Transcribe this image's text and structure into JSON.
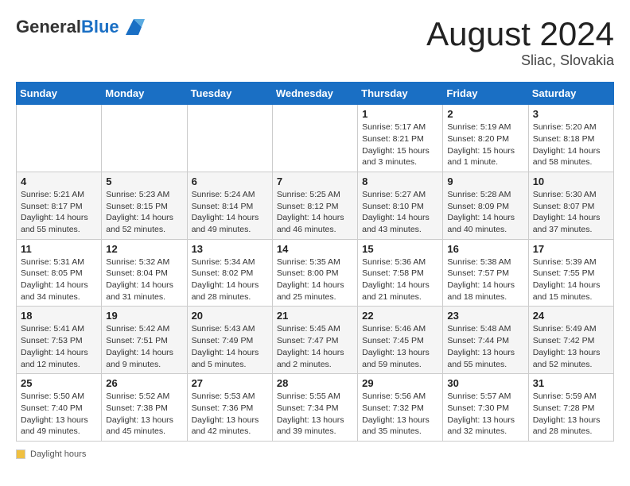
{
  "header": {
    "logo_general": "General",
    "logo_blue": "Blue",
    "month": "August 2024",
    "location": "Sliac, Slovakia"
  },
  "footer": {
    "label": "Daylight hours"
  },
  "weekdays": [
    "Sunday",
    "Monday",
    "Tuesday",
    "Wednesday",
    "Thursday",
    "Friday",
    "Saturday"
  ],
  "weeks": [
    [
      {
        "day": "",
        "info": ""
      },
      {
        "day": "",
        "info": ""
      },
      {
        "day": "",
        "info": ""
      },
      {
        "day": "",
        "info": ""
      },
      {
        "day": "1",
        "info": "Sunrise: 5:17 AM\nSunset: 8:21 PM\nDaylight: 15 hours\nand 3 minutes."
      },
      {
        "day": "2",
        "info": "Sunrise: 5:19 AM\nSunset: 8:20 PM\nDaylight: 15 hours\nand 1 minute."
      },
      {
        "day": "3",
        "info": "Sunrise: 5:20 AM\nSunset: 8:18 PM\nDaylight: 14 hours\nand 58 minutes."
      }
    ],
    [
      {
        "day": "4",
        "info": "Sunrise: 5:21 AM\nSunset: 8:17 PM\nDaylight: 14 hours\nand 55 minutes."
      },
      {
        "day": "5",
        "info": "Sunrise: 5:23 AM\nSunset: 8:15 PM\nDaylight: 14 hours\nand 52 minutes."
      },
      {
        "day": "6",
        "info": "Sunrise: 5:24 AM\nSunset: 8:14 PM\nDaylight: 14 hours\nand 49 minutes."
      },
      {
        "day": "7",
        "info": "Sunrise: 5:25 AM\nSunset: 8:12 PM\nDaylight: 14 hours\nand 46 minutes."
      },
      {
        "day": "8",
        "info": "Sunrise: 5:27 AM\nSunset: 8:10 PM\nDaylight: 14 hours\nand 43 minutes."
      },
      {
        "day": "9",
        "info": "Sunrise: 5:28 AM\nSunset: 8:09 PM\nDaylight: 14 hours\nand 40 minutes."
      },
      {
        "day": "10",
        "info": "Sunrise: 5:30 AM\nSunset: 8:07 PM\nDaylight: 14 hours\nand 37 minutes."
      }
    ],
    [
      {
        "day": "11",
        "info": "Sunrise: 5:31 AM\nSunset: 8:05 PM\nDaylight: 14 hours\nand 34 minutes."
      },
      {
        "day": "12",
        "info": "Sunrise: 5:32 AM\nSunset: 8:04 PM\nDaylight: 14 hours\nand 31 minutes."
      },
      {
        "day": "13",
        "info": "Sunrise: 5:34 AM\nSunset: 8:02 PM\nDaylight: 14 hours\nand 28 minutes."
      },
      {
        "day": "14",
        "info": "Sunrise: 5:35 AM\nSunset: 8:00 PM\nDaylight: 14 hours\nand 25 minutes."
      },
      {
        "day": "15",
        "info": "Sunrise: 5:36 AM\nSunset: 7:58 PM\nDaylight: 14 hours\nand 21 minutes."
      },
      {
        "day": "16",
        "info": "Sunrise: 5:38 AM\nSunset: 7:57 PM\nDaylight: 14 hours\nand 18 minutes."
      },
      {
        "day": "17",
        "info": "Sunrise: 5:39 AM\nSunset: 7:55 PM\nDaylight: 14 hours\nand 15 minutes."
      }
    ],
    [
      {
        "day": "18",
        "info": "Sunrise: 5:41 AM\nSunset: 7:53 PM\nDaylight: 14 hours\nand 12 minutes."
      },
      {
        "day": "19",
        "info": "Sunrise: 5:42 AM\nSunset: 7:51 PM\nDaylight: 14 hours\nand 9 minutes."
      },
      {
        "day": "20",
        "info": "Sunrise: 5:43 AM\nSunset: 7:49 PM\nDaylight: 14 hours\nand 5 minutes."
      },
      {
        "day": "21",
        "info": "Sunrise: 5:45 AM\nSunset: 7:47 PM\nDaylight: 14 hours\nand 2 minutes."
      },
      {
        "day": "22",
        "info": "Sunrise: 5:46 AM\nSunset: 7:45 PM\nDaylight: 13 hours\nand 59 minutes."
      },
      {
        "day": "23",
        "info": "Sunrise: 5:48 AM\nSunset: 7:44 PM\nDaylight: 13 hours\nand 55 minutes."
      },
      {
        "day": "24",
        "info": "Sunrise: 5:49 AM\nSunset: 7:42 PM\nDaylight: 13 hours\nand 52 minutes."
      }
    ],
    [
      {
        "day": "25",
        "info": "Sunrise: 5:50 AM\nSunset: 7:40 PM\nDaylight: 13 hours\nand 49 minutes."
      },
      {
        "day": "26",
        "info": "Sunrise: 5:52 AM\nSunset: 7:38 PM\nDaylight: 13 hours\nand 45 minutes."
      },
      {
        "day": "27",
        "info": "Sunrise: 5:53 AM\nSunset: 7:36 PM\nDaylight: 13 hours\nand 42 minutes."
      },
      {
        "day": "28",
        "info": "Sunrise: 5:55 AM\nSunset: 7:34 PM\nDaylight: 13 hours\nand 39 minutes."
      },
      {
        "day": "29",
        "info": "Sunrise: 5:56 AM\nSunset: 7:32 PM\nDaylight: 13 hours\nand 35 minutes."
      },
      {
        "day": "30",
        "info": "Sunrise: 5:57 AM\nSunset: 7:30 PM\nDaylight: 13 hours\nand 32 minutes."
      },
      {
        "day": "31",
        "info": "Sunrise: 5:59 AM\nSunset: 7:28 PM\nDaylight: 13 hours\nand 28 minutes."
      }
    ]
  ]
}
